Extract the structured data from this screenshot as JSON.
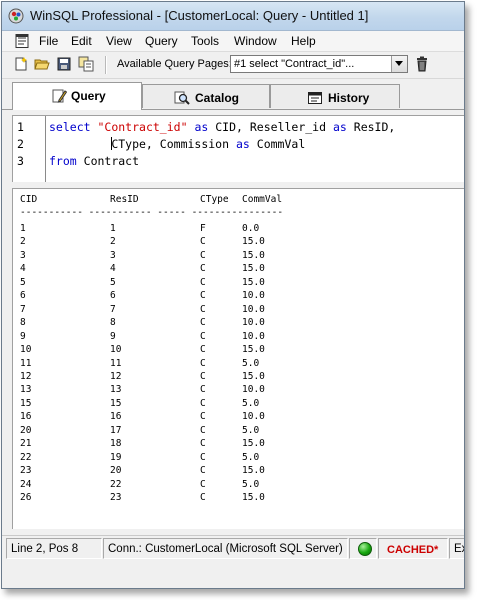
{
  "window": {
    "title": "WinSQL Professional - [CustomerLocal: Query - Untitled 1]"
  },
  "menu": {
    "items": [
      "File",
      "Edit",
      "View",
      "Query",
      "Tools",
      "Window",
      "Help"
    ]
  },
  "toolbar": {
    "icons": [
      "new-icon",
      "open-folder-icon",
      "save-icon",
      "copy-icon",
      "trash-icon"
    ],
    "query_pages_label": "Available Query Pages:",
    "query_pages_value": "#1 select \"Contract_id\"..."
  },
  "tabs": [
    {
      "label": "Query",
      "icon": "pencil-icon",
      "active": true
    },
    {
      "label": "Catalog",
      "icon": "magnifier-icon",
      "active": false
    },
    {
      "label": "History",
      "icon": "history-icon",
      "active": false
    }
  ],
  "editor": {
    "line_numbers": [
      "1",
      "2",
      "3"
    ],
    "line1": {
      "kw1": "select",
      "str1": "\"Contract_id\"",
      "kw2": "as",
      "t1": "CID,",
      "t2": "Reseller_id",
      "kw3": "as",
      "t3": "ResID,"
    },
    "line2": {
      "t1": "CType,",
      "t2": "Commission",
      "kw1": "as",
      "t3": "CommVal"
    },
    "line3": {
      "kw1": "from",
      "t1": "Contract"
    }
  },
  "results": {
    "columns": [
      "CID",
      "ResID",
      "CType",
      "CommVal"
    ],
    "separator": "----------- ----------- ----- ----------------",
    "rows": [
      [
        "1",
        "1",
        "F",
        "0.0"
      ],
      [
        "2",
        "2",
        "C",
        "15.0"
      ],
      [
        "3",
        "3",
        "C",
        "15.0"
      ],
      [
        "4",
        "4",
        "C",
        "15.0"
      ],
      [
        "5",
        "5",
        "C",
        "15.0"
      ],
      [
        "6",
        "6",
        "C",
        "10.0"
      ],
      [
        "7",
        "7",
        "C",
        "10.0"
      ],
      [
        "8",
        "8",
        "C",
        "10.0"
      ],
      [
        "9",
        "9",
        "C",
        "10.0"
      ],
      [
        "10",
        "10",
        "C",
        "15.0"
      ],
      [
        "11",
        "11",
        "C",
        "5.0"
      ],
      [
        "12",
        "12",
        "C",
        "15.0"
      ],
      [
        "13",
        "13",
        "C",
        "10.0"
      ],
      [
        "15",
        "15",
        "C",
        "5.0"
      ],
      [
        "16",
        "16",
        "C",
        "10.0"
      ],
      [
        "20",
        "17",
        "C",
        "5.0"
      ],
      [
        "21",
        "18",
        "C",
        "15.0"
      ],
      [
        "22",
        "19",
        "C",
        "5.0"
      ],
      [
        "23",
        "20",
        "C",
        "15.0"
      ],
      [
        "24",
        "22",
        "C",
        "5.0"
      ],
      [
        "26",
        "23",
        "C",
        "15.0"
      ]
    ]
  },
  "status": {
    "position": "Line 2, Pos 8",
    "connection": "Conn.: CustomerLocal (Microsoft SQL Server)",
    "cached": "CACHED*",
    "trailing": "Ex",
    "connected_color": "#17a80f",
    "cached_color": "#cc0000"
  }
}
